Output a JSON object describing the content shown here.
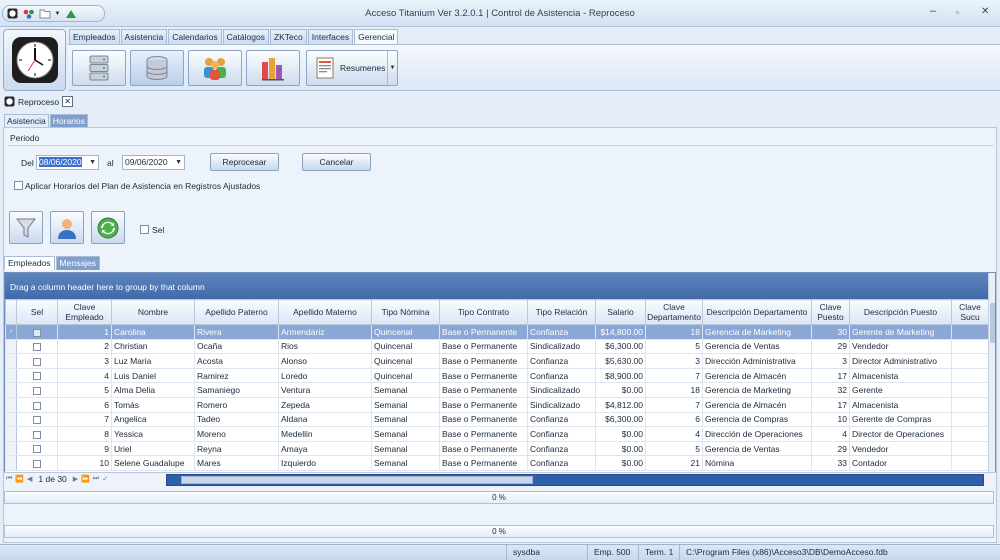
{
  "window": {
    "title": "Acceso Titanium  Ver 3.2.0.1 | Control de Asistencia - Reproceso",
    "minimize_icon": "minimize-icon",
    "maximize_icon": "maximize-icon",
    "close_icon": "close-icon"
  },
  "quick_access": [
    {
      "name": "app-icon"
    },
    {
      "name": "tools-icon"
    },
    {
      "name": "folder-icon"
    },
    {
      "name": "chevron-down-icon"
    },
    {
      "name": "up-arrow-icon"
    }
  ],
  "ribbon": {
    "tabs": [
      "Empleados",
      "Asistencia",
      "Calendarios",
      "Catálogos",
      "ZKTeco",
      "Interfaces",
      "Gerencial"
    ],
    "active_tab": "Gerencial",
    "buttons": [
      {
        "name": "server-icon"
      },
      {
        "name": "database-icon"
      },
      {
        "name": "users-icon"
      },
      {
        "name": "reports-icon"
      }
    ],
    "resumenes_label": "Resumenes"
  },
  "document_tab": {
    "label": "Reproceso",
    "close": "✕"
  },
  "subtabs": [
    "Asistencia",
    "Horarios"
  ],
  "period": {
    "section_label": "Periodo",
    "del_label": "Del",
    "from_date": "08/06/2020",
    "al_label": "al",
    "to_date": "09/06/2020",
    "reprocess_button": "Reprocesar",
    "cancel_button": "Cancelar",
    "apply_checkbox_label": "Aplicar Horarios del Plan de Asistencia en Registros Ajustados"
  },
  "tools": {
    "filter_icon": "filter-icon",
    "employee_icon": "employee-icon",
    "refresh_icon": "refresh-icon",
    "sel_label": "Sel"
  },
  "grid_tabs": [
    "Empleados",
    "Mensajes"
  ],
  "grid": {
    "group_hint": "Drag a column header here to group by that column",
    "columns": [
      "Sel",
      "Clave\nEmpleado",
      "Nombre",
      "Apellido Paterno",
      "Apellido Materno",
      "Tipo Nómina",
      "Tipo Contrato",
      "Tipo Relación",
      "Salario",
      "Clave\nDepartamento",
      "Descripción Departamento",
      "Clave\nPuesto",
      "Descripción Puesto",
      "Clave\nSucu"
    ],
    "rows": [
      [
        "1",
        "Carolina",
        "Rivera",
        "Armendariz",
        "Quincenal",
        "Base o Permanente",
        "Confianza",
        "$14,800.00",
        "18",
        "Gerencia de Marketing",
        "30",
        "Gerente de Marketing",
        ""
      ],
      [
        "2",
        "Christian",
        "Ocaña",
        "Rios",
        "Quincenal",
        "Base o Permanente",
        "Sindicalizado",
        "$6,300.00",
        "5",
        "Gerencia de Ventas",
        "29",
        "Vendedor",
        ""
      ],
      [
        "3",
        "Luz Maria",
        "Acosta",
        "Alonso",
        "Quincenal",
        "Base o Permanente",
        "Confianza",
        "$5,630.00",
        "3",
        "Dirección Administrativa",
        "3",
        "Director Administrativo",
        ""
      ],
      [
        "4",
        "Luis Daniel",
        "Ramirez",
        "Loredo",
        "Quincenal",
        "Base o Permanente",
        "Confianza",
        "$8,900.00",
        "7",
        "Gerencia de Almacén",
        "17",
        "Almacenista",
        ""
      ],
      [
        "5",
        "Alma Delia",
        "Samaniego",
        "Ventura",
        "Semanal",
        "Base o Permanente",
        "Sindicalizado",
        "$0.00",
        "18",
        "Gerencia de Marketing",
        "32",
        "Gerente",
        ""
      ],
      [
        "6",
        "Tomás",
        "Romero",
        "Zepeda",
        "Semanal",
        "Base o Permanente",
        "Sindicalizado",
        "$4,812.00",
        "7",
        "Gerencia de Almacén",
        "17",
        "Almacenista",
        ""
      ],
      [
        "7",
        "Angelica",
        "Tadeo",
        "Aldana",
        "Semanal",
        "Base o Permanente",
        "Confianza",
        "$6,300.00",
        "6",
        "Gerencia de Compras",
        "10",
        "Gerente de Compras",
        ""
      ],
      [
        "8",
        "Yessica",
        "Moreno",
        "Medellin",
        "Semanal",
        "Base o Permanente",
        "Confianza",
        "$0.00",
        "4",
        "Dirección de Operaciones",
        "4",
        "Director de Operaciones",
        ""
      ],
      [
        "9",
        "Uriel",
        "Reyna",
        "Amaya",
        "Semanal",
        "Base o Permanente",
        "Confianza",
        "$0.00",
        "5",
        "Gerencia de Ventas",
        "29",
        "Vendedor",
        ""
      ],
      [
        "10",
        "Selene Guadalupe",
        "Mares",
        "Izquierdo",
        "Semanal",
        "Base o Permanente",
        "Confianza",
        "$0.00",
        "21",
        "Nómina",
        "33",
        "Contador",
        ""
      ]
    ],
    "page_info": "1 de 30"
  },
  "progress": [
    {
      "label": "0 %",
      "value": 0
    },
    {
      "label": "0 %",
      "value": 0
    }
  ],
  "status": {
    "user": "sysdba",
    "emp": "Emp. 500",
    "term": "Term. 1",
    "path": "C:\\Program Files (x86)\\Acceso3\\DB\\DemoAcceso.fdb"
  }
}
